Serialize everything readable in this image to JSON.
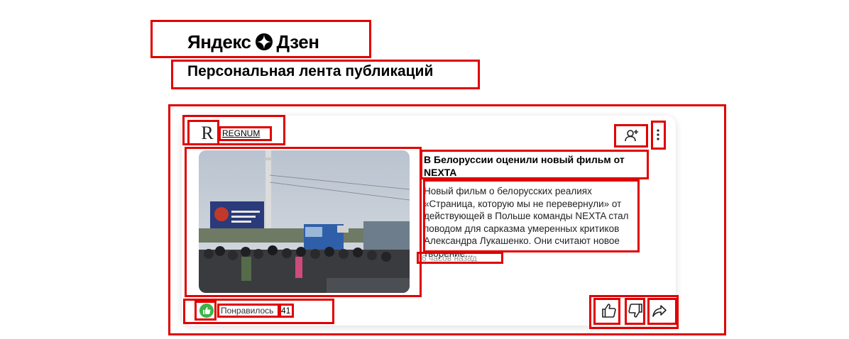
{
  "header": {
    "logo_part1": "Яндекс",
    "logo_part2": "Дзен",
    "logo_icon": "zen-star-icon",
    "page_title": "Персональная лента публикаций"
  },
  "card": {
    "source": {
      "logo_letter": "R",
      "name": "REGNUM"
    },
    "actions_icons": {
      "subscribe": "subscribe-person-plus-icon",
      "menu": "vertical-dots-icon"
    },
    "title": "В Белоруссии оценили новый фильм от NEXTA",
    "snippet": "Новый фильм о белорусских реалиях «Страница, которую мы не перевернули» от действующей в Польше команды NEXTA стал поводом для сарказма умеренных критиков Александра Лукашенко. Они считают новое творение...",
    "time": "6 часов назад",
    "likes": {
      "label": "Понравилось",
      "count": "41",
      "badge_color": "#3bb54a"
    },
    "footer_icons": [
      "thumb-up-icon",
      "thumb-down-icon",
      "share-icon"
    ]
  },
  "colors": {
    "annotation": "#e00000",
    "timestamp": "#999999"
  }
}
